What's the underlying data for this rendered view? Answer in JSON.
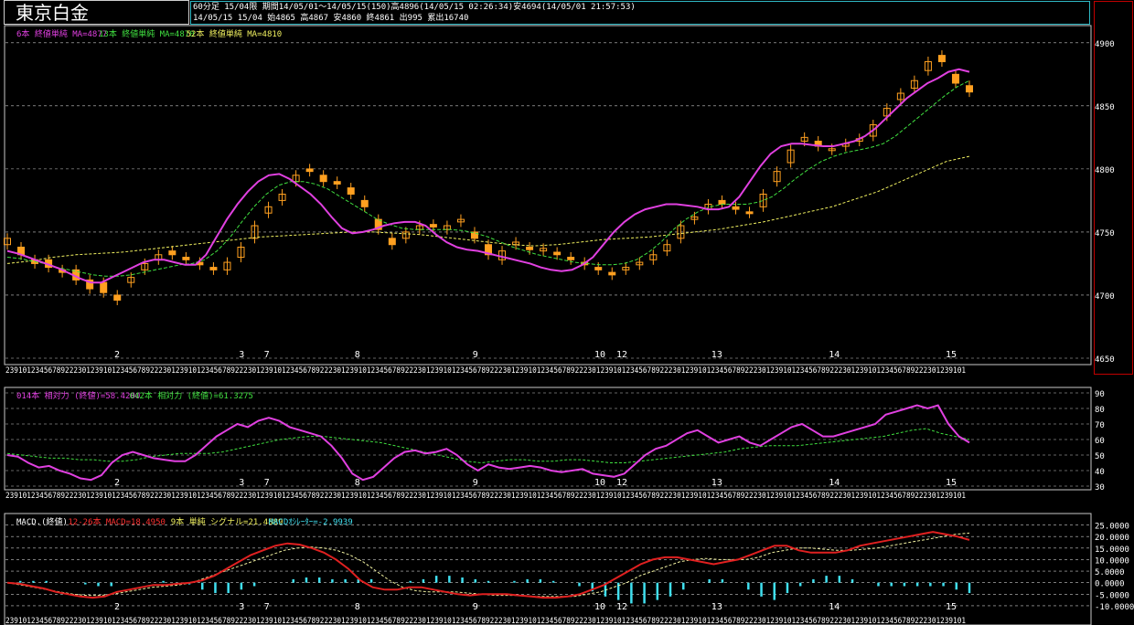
{
  "header": {
    "title": "東京白金",
    "info_line1": "60分足 15/04限  期間14/05/01～14/05/15(150)高4896(14/05/15 02:26:34)安4694(14/05/01 21:57:53)",
    "info_line2": "14/05/15 15/04 始4865 高4867 安4860 終4861 出995 累出16740"
  },
  "price_panel": {
    "legend": [
      {
        "text": "6本 終値単純 MA=4877",
        "color": "#e040e0"
      },
      {
        "text": "13本 終値単純 MA=4870",
        "color": "#40e040"
      },
      {
        "text": "52本 終値単純 MA=4810",
        "color": "#f0f060"
      }
    ],
    "y_ticks": [
      "4900",
      "4850",
      "4800",
      "4750",
      "4700",
      "4650"
    ],
    "date_labels": [
      {
        "text": "2",
        "at": 0.195
      },
      {
        "text": "3",
        "at": 0.422
      },
      {
        "text": "7",
        "at": 0.468
      },
      {
        "text": "8",
        "at": 0.633
      },
      {
        "text": "9",
        "at": 0.848
      },
      {
        "text": "10",
        "at": 1.07
      },
      {
        "text": "12",
        "at": 1.11
      },
      {
        "text": "13",
        "at": 1.283
      },
      {
        "text": "14",
        "at": 1.497
      },
      {
        "text": "15",
        "at": 1.71
      }
    ],
    "hour_axis_text": "2391012345678922230123910123456789222301239101234567892223012391012345678922230123910123456789222301239101234567892223012391012345678922230123910123456789222301239101234567892223012391012345678922230123910123456789222301239101"
  },
  "rsi_panel": {
    "legend": [
      {
        "text": "014本 相対力 (終値)=58.4200",
        "color": "#e040e0"
      },
      {
        "text": "042本 相対力 (終値)=61.3275",
        "color": "#40e040"
      }
    ],
    "y_ticks": [
      "90",
      "80",
      "70",
      "60",
      "50",
      "40",
      "30"
    ]
  },
  "macd_panel": {
    "legend": [
      {
        "text": "MACD.(終値)",
        "color": "#ffffff"
      },
      {
        "text": "12-26本 MACD=18.4950",
        "color": "#ff3030"
      },
      {
        "text": "9本 単純 シグナル=21.4889",
        "color": "#f0f060"
      },
      {
        "text": "MACDｵｼﾚｰﾀｰ=-2.9939",
        "color": "#40e0f0"
      }
    ],
    "y_ticks": [
      "25.0000",
      "20.0000",
      "15.0000",
      "10.0000",
      "5.0000",
      "0.0000",
      "-5.0000",
      "-10.0000"
    ]
  },
  "colors": {
    "candle": "#ffa020",
    "ma6": "#e040e0",
    "ma13": "#40e040",
    "ma52": "#f0f060",
    "macd": "#e02020",
    "signal": "#f0f0a0",
    "osc": "#40e0f0",
    "grid": "#c8c8c8",
    "panel_border": "#c8c8c8",
    "header_border": "#2fb8c4"
  },
  "chart_data": [
    {
      "type": "candlestick",
      "title": "東京白金 60分足 15/04限",
      "x": "hourly bars 14/05/01 to 14/05/15 (150 bars)",
      "ylim": [
        4650,
        4910
      ],
      "grid": true,
      "ohlc_path": [
        [
          4740,
          4745
        ],
        [
          4738,
          4732
        ],
        [
          4728,
          4725
        ],
        [
          4728,
          4722
        ],
        [
          4720,
          4718
        ],
        [
          4720,
          4712
        ],
        [
          4712,
          4705
        ],
        [
          4710,
          4702
        ],
        [
          4700,
          4696
        ],
        [
          4710,
          4714
        ],
        [
          4720,
          4725
        ],
        [
          4728,
          4732
        ],
        [
          4735,
          4732
        ],
        [
          4730,
          4728
        ],
        [
          4726,
          4724
        ],
        [
          4722,
          4720
        ],
        [
          4720,
          4726
        ],
        [
          4730,
          4738
        ],
        [
          4745,
          4755
        ],
        [
          4765,
          4770
        ],
        [
          4775,
          4780
        ],
        [
          4790,
          4795
        ],
        [
          4800,
          4798
        ],
        [
          4795,
          4790
        ],
        [
          4790,
          4788
        ],
        [
          4785,
          4780
        ],
        [
          4775,
          4770
        ],
        [
          4760,
          4752
        ],
        [
          4745,
          4740
        ],
        [
          4745,
          4750
        ],
        [
          4752,
          4755
        ],
        [
          4756,
          4754
        ],
        [
          4752,
          4755
        ],
        [
          4758,
          4760
        ],
        [
          4750,
          4745
        ],
        [
          4740,
          4732
        ],
        [
          4728,
          4735
        ],
        [
          4740,
          4742
        ],
        [
          4738,
          4736
        ],
        [
          4735,
          4737
        ],
        [
          4734,
          4732
        ],
        [
          4730,
          4728
        ],
        [
          4726,
          4724
        ],
        [
          4722,
          4720
        ],
        [
          4718,
          4716
        ],
        [
          4720,
          4722
        ],
        [
          4724,
          4726
        ],
        [
          4728,
          4732
        ],
        [
          4735,
          4740
        ],
        [
          4745,
          4755
        ],
        [
          4760,
          4762
        ],
        [
          4768,
          4772
        ],
        [
          4775,
          4772
        ],
        [
          4770,
          4768
        ],
        [
          4766,
          4765
        ],
        [
          4770,
          4780
        ],
        [
          4790,
          4798
        ],
        [
          4805,
          4815
        ],
        [
          4822,
          4825
        ],
        [
          4822,
          4818
        ],
        [
          4815,
          4816
        ],
        [
          4818,
          4820
        ],
        [
          4822,
          4824
        ],
        [
          4826,
          4835
        ],
        [
          4842,
          4848
        ],
        [
          4855,
          4860
        ],
        [
          4864,
          4870
        ],
        [
          4878,
          4885
        ],
        [
          4890,
          4885
        ],
        [
          4875,
          4868
        ],
        [
          4866,
          4861
        ]
      ],
      "ma6_path": [
        4735,
        4733,
        4730,
        4727,
        4724,
        4721,
        4717,
        4713,
        4710,
        4710,
        4714,
        4718,
        4722,
        4726,
        4728,
        4728,
        4726,
        4724,
        4724,
        4732,
        4746,
        4760,
        4772,
        4782,
        4790,
        4795,
        4796,
        4792,
        4786,
        4780,
        4772,
        4762,
        4753,
        4749,
        4750,
        4752,
        4755,
        4757,
        4758,
        4758,
        4755,
        4748,
        4742,
        4738,
        4736,
        4735,
        4733,
        4731,
        4729,
        4727,
        4725,
        4722,
        4720,
        4719,
        4720,
        4724,
        4730,
        4740,
        4750,
        4758,
        4764,
        4768,
        4770,
        4772,
        4772,
        4771,
        4770,
        4768,
        4768,
        4770,
        4778,
        4790,
        4802,
        4812,
        4818,
        4820,
        4820,
        4819,
        4818,
        4818,
        4820,
        4822,
        4826,
        4832,
        4840,
        4848,
        4856,
        4862,
        4868,
        4872,
        4877,
        4879,
        4877
      ],
      "ma13_path": [
        4730,
        4729,
        4727,
        4725,
        4722,
        4720,
        4718,
        4716,
        4715,
        4715,
        4716,
        4718,
        4720,
        4722,
        4724,
        4725,
        4728,
        4735,
        4745,
        4758,
        4770,
        4780,
        4787,
        4790,
        4790,
        4788,
        4784,
        4778,
        4772,
        4766,
        4760,
        4756,
        4753,
        4752,
        4752,
        4752,
        4752,
        4751,
        4749,
        4746,
        4742,
        4738,
        4735,
        4732,
        4730,
        4728,
        4726,
        4725,
        4724,
        4724,
        4725,
        4728,
        4734,
        4742,
        4752,
        4760,
        4766,
        4770,
        4772,
        4772,
        4772,
        4774,
        4778,
        4785,
        4793,
        4800,
        4806,
        4810,
        4813,
        4815,
        4817,
        4820,
        4826,
        4834,
        4842,
        4850,
        4858,
        4865,
        4870
      ],
      "ma52_path": [
        4725,
        4727,
        4730,
        4732,
        4733,
        4734,
        4736,
        4738,
        4740,
        4742,
        4744,
        4746,
        4747,
        4748,
        4749,
        4750,
        4750,
        4749,
        4748,
        4746,
        4744,
        4742,
        4740,
        4739,
        4740,
        4742,
        4744,
        4745,
        4746,
        4748,
        4750,
        4752,
        4755,
        4758,
        4762,
        4766,
        4770,
        4776,
        4782,
        4790,
        4798,
        4806,
        4810
      ]
    },
    {
      "type": "line",
      "title": "相対力 (RSI)",
      "ylim": [
        30,
        90
      ],
      "series": [
        {
          "name": "014本 相対力 (終値)",
          "values": [
            50,
            49,
            45,
            42,
            43,
            40,
            38,
            35,
            34,
            37,
            45,
            50,
            52,
            50,
            48,
            47,
            46,
            46,
            50,
            56,
            62,
            66,
            70,
            68,
            72,
            74,
            72,
            68,
            66,
            64,
            62,
            56,
            48,
            38,
            34,
            36,
            42,
            48,
            52,
            53,
            51,
            52,
            54,
            50,
            44,
            40,
            44,
            42,
            41,
            42,
            43,
            42,
            40,
            39,
            40,
            41,
            38,
            37,
            36,
            38,
            44,
            50,
            54,
            56,
            60,
            64,
            66,
            62,
            58,
            60,
            62,
            58,
            56,
            60,
            64,
            68,
            70,
            66,
            62,
            62,
            64,
            66,
            68,
            70,
            76,
            78,
            80,
            82,
            80,
            82,
            70,
            62,
            58
          ]
        },
        {
          "name": "042本 相対力 (終値)",
          "values": [
            51,
            50,
            49,
            48,
            48,
            47,
            47,
            46,
            46,
            47,
            49,
            50,
            51,
            51,
            51,
            52,
            54,
            56,
            58,
            60,
            61,
            62,
            62,
            61,
            60,
            59,
            58,
            56,
            54,
            52,
            50,
            48,
            46,
            45,
            46,
            47,
            47,
            46,
            46,
            47,
            47,
            46,
            45,
            45,
            46,
            47,
            48,
            49,
            50,
            51,
            52,
            54,
            55,
            56,
            56,
            56,
            57,
            58,
            59,
            60,
            61,
            62,
            64,
            66,
            67,
            64,
            62,
            60
          ]
        }
      ]
    },
    {
      "type": "line",
      "title": "MACD.(終値)",
      "ylim": [
        -12,
        26
      ],
      "series": [
        {
          "name": "12-26本 MACD",
          "values": [
            0,
            -0.5,
            -1.5,
            -2.5,
            -4,
            -5,
            -6,
            -6.5,
            -6,
            -4,
            -3,
            -2,
            -1,
            -1,
            -0.5,
            0,
            1,
            3,
            6,
            9,
            12,
            14,
            16,
            17,
            16.5,
            15,
            13,
            10,
            6,
            1,
            -2,
            -3,
            -3,
            -2,
            -2,
            -3,
            -4,
            -5,
            -5.5,
            -5,
            -5,
            -5,
            -5.5,
            -6,
            -6.5,
            -6.5,
            -6,
            -5,
            -3,
            -1,
            2,
            5,
            8,
            10,
            11,
            11,
            10,
            9,
            8,
            9,
            10,
            12,
            14,
            16,
            16,
            14,
            13,
            13,
            13,
            14,
            16,
            17,
            18,
            19,
            20,
            21,
            22,
            21,
            20,
            18.5
          ]
        },
        {
          "name": "9本 単純 シグナル",
          "values": [
            0,
            -1,
            -2,
            -3,
            -4,
            -5,
            -5.5,
            -5.5,
            -5,
            -4,
            -3,
            -2,
            -1.5,
            -1,
            0,
            2,
            4,
            6,
            8,
            10,
            12,
            14,
            15,
            15.5,
            15,
            14,
            12,
            9,
            5,
            1,
            -2,
            -3.5,
            -4,
            -4,
            -4,
            -4.5,
            -5,
            -5.5,
            -5.5,
            -5.5,
            -6,
            -6,
            -6,
            -6,
            -5,
            -4,
            -2,
            0,
            3,
            5,
            7,
            9,
            10,
            10.5,
            10,
            10,
            10,
            11,
            13,
            14,
            15,
            15,
            14.5,
            14,
            14,
            14.5,
            15,
            16,
            17,
            18,
            19,
            20,
            21,
            21.5
          ]
        },
        {
          "name": "MACDｵｼﾚｰﾀｰ",
          "values": [
            0,
            0.5,
            0.5,
            0.5,
            0,
            0,
            -0.5,
            -1,
            -1,
            0,
            0,
            0,
            0.5,
            0,
            -0.5,
            -2,
            -3,
            -3,
            -2,
            -1,
            0,
            0,
            1,
            1.5,
            1.5,
            1,
            1,
            1,
            1,
            0,
            0,
            0.5,
            1,
            2,
            2,
            1.5,
            1,
            0.5,
            0,
            0.5,
            1,
            1,
            0.5,
            0,
            -1,
            -2.5,
            -4,
            -5,
            -6,
            -6,
            -5,
            -4,
            -2,
            0,
            1,
            1,
            0,
            -2,
            -4,
            -5,
            -3,
            -1,
            1,
            2,
            2,
            1,
            0,
            -1,
            -1,
            -1,
            -1,
            -1,
            -1,
            -2,
            -3
          ]
        }
      ]
    }
  ]
}
